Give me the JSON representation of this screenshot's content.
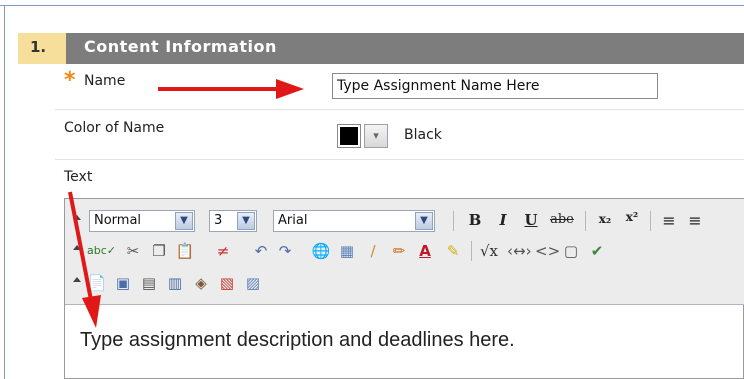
{
  "section": {
    "number": "1.",
    "title": "Content Information"
  },
  "fields": {
    "name_label": "Name",
    "required_marker": "*",
    "name_value": "Type Assignment Name Here",
    "color_label": "Color of Name",
    "color_value": "Black",
    "text_label": "Text"
  },
  "editor": {
    "format_select": "Normal",
    "size_select": "3",
    "font_select": "Arial",
    "body_text": "Type assignment description and deadlines here."
  },
  "colors": {
    "header_bg": "#7d7d7d",
    "step_bg": "#f5df9a",
    "required_star": "#f08a14",
    "annotation_arrow": "#e01818"
  }
}
